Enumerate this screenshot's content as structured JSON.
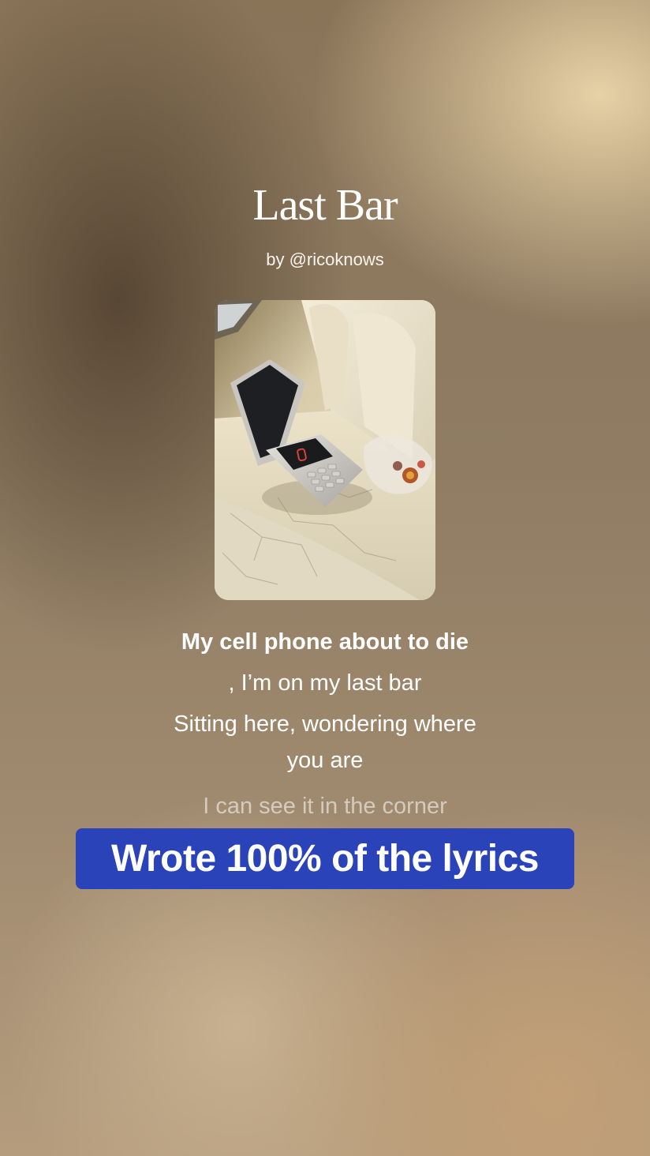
{
  "song": {
    "title": "Last Bar",
    "byline": "by @ricoknows",
    "cover_image": "flip-phone-on-car-seat"
  },
  "lyrics": {
    "current": "My cell phone about to die",
    "lines": [
      ", I’m on my last bar",
      "Sitting here, wondering where",
      "you are",
      "I can see it in the corner"
    ]
  },
  "caption": {
    "text": "Wrote 100% of the lyrics",
    "background_color": "#2a43b8"
  }
}
